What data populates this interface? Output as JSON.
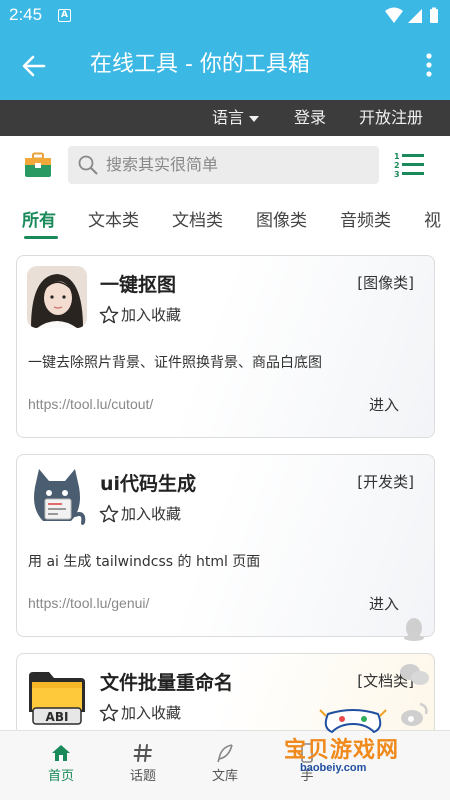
{
  "status_bar": {
    "time": "2:45",
    "notification_letter": "A"
  },
  "app_bar": {
    "title": "在线工具 - 你的工具箱"
  },
  "top_links": {
    "language": "语言",
    "login": "登录",
    "register": "开放注册"
  },
  "search": {
    "placeholder": "搜索其实很简单"
  },
  "tabs": [
    {
      "label": "所有",
      "active": true
    },
    {
      "label": "文本类"
    },
    {
      "label": "文档类"
    },
    {
      "label": "图像类"
    },
    {
      "label": "音频类"
    },
    {
      "label": "视"
    }
  ],
  "cards": [
    {
      "title": "一键抠图",
      "tag": "[图像类]",
      "fav_label": "加入收藏",
      "description": "一键去除照片背景、证件照换背景、商品白底图",
      "url": "https://tool.lu/cutout/",
      "enter_label": "进入"
    },
    {
      "title": "ui代码生成",
      "tag": "[开发类]",
      "fav_label": "加入收藏",
      "description": "用 ai 生成 tailwindcss 的 html 页面",
      "url": "https://tool.lu/genui/",
      "enter_label": "进入"
    },
    {
      "title": "文件批量重命名",
      "tag": "[文档类]",
      "fav_label": "加入收藏",
      "thumb_text": "ABI"
    }
  ],
  "bottom_nav": [
    {
      "label": "首页",
      "icon": "home-icon",
      "active": true
    },
    {
      "label": "话题",
      "icon": "hash-icon"
    },
    {
      "label": "文库",
      "icon": "feather-icon"
    },
    {
      "label": "手",
      "icon": "phone-icon"
    }
  ],
  "watermark": {
    "text": "宝贝游戏网",
    "url": "baobeiy.com"
  },
  "colors": {
    "primary": "#3cb8e4",
    "accent": "#1a8a5a",
    "dark_bar": "#3c3c3c"
  }
}
